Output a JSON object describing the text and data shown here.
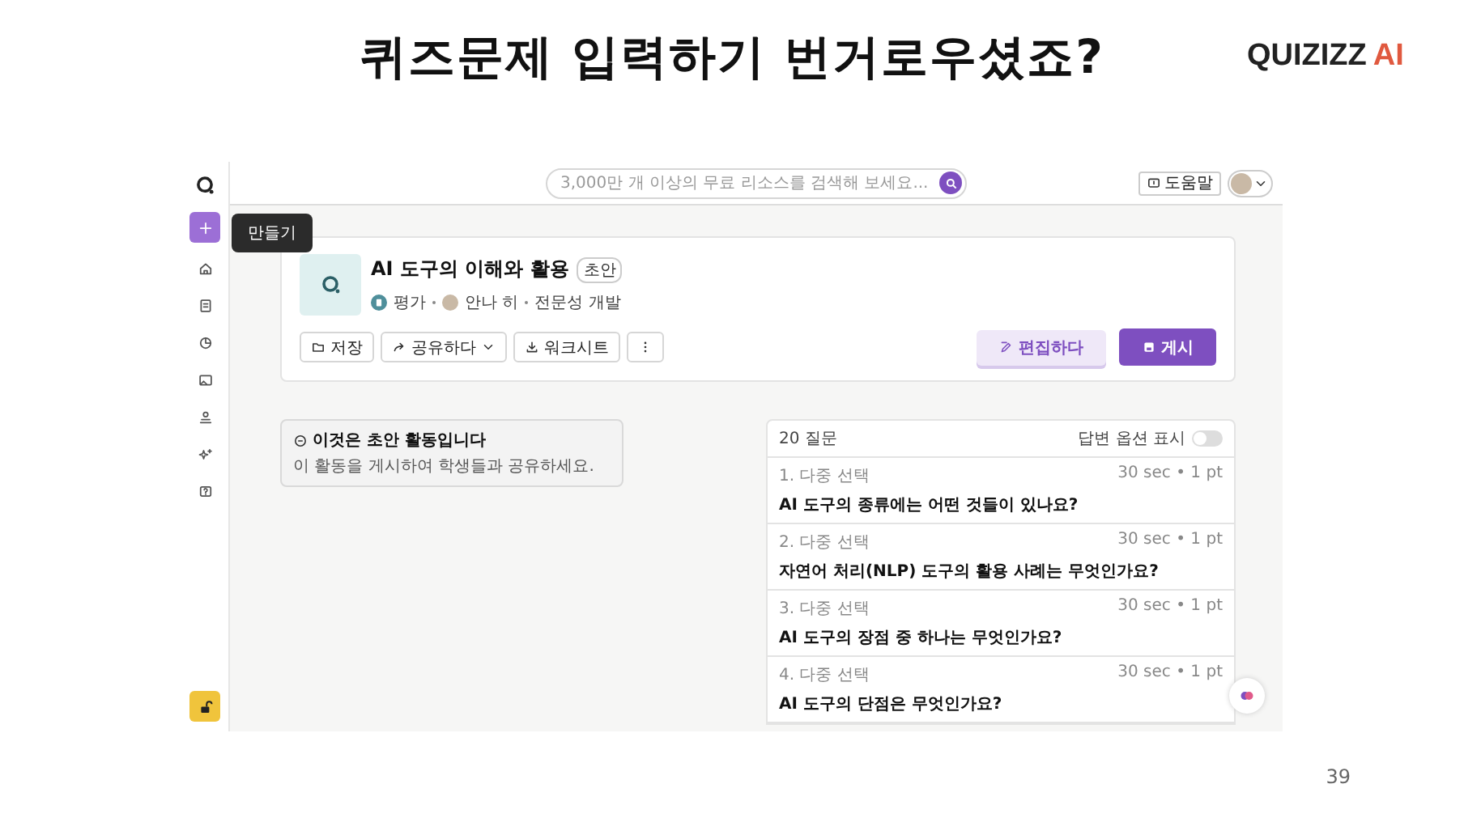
{
  "slide": {
    "title": "퀴즈문제 입력하기 번거로우셨죠?",
    "logo": {
      "word": "QUIZIZZ",
      "ai": "AI"
    },
    "page_number": "39"
  },
  "app": {
    "search": {
      "placeholder": "3,000만 개 이상의 무료 리소스를 검색해 보세요..."
    },
    "help_button": "도움말",
    "tooltip": "만들기",
    "activity": {
      "title": "AI 도구의 이해와 활용",
      "badge": "초안",
      "type": "평가",
      "author": "안나 히",
      "category": "전문성 개발",
      "actions": [
        {
          "kind": "folder",
          "label": "저장"
        },
        {
          "kind": "share",
          "label": "공유하다"
        },
        {
          "kind": "download",
          "label": "워크시트"
        },
        {
          "kind": "more"
        }
      ],
      "edit_button": "편집하다",
      "publish_button": "게시"
    },
    "draft_notice": {
      "title": "이것은 초안 활동입니다",
      "text": "이 활동을 게시하여 학생들과 공유하세요."
    },
    "questions": {
      "count": "20 질문",
      "toggle_label": "답변 옵션 표시",
      "toggle_on": false,
      "items": [
        {
          "type": "1. 다중 선택",
          "meta": "30 sec • 1 pt",
          "text": "AI 도구의 종류에는 어떤 것들이 있나요?"
        },
        {
          "type": "2. 다중 선택",
          "meta": "30 sec • 1 pt",
          "text": "자연어 처리(NLP) 도구의 활용 사례는 무엇인가요?"
        },
        {
          "type": "3. 다중 선택",
          "meta": "30 sec • 1 pt",
          "text": "AI 도구의 장점 중 하나는 무엇인가요?"
        },
        {
          "type": "4. 다중 선택",
          "meta": "30 sec • 1 pt",
          "text": "AI 도구의 단점은 무엇인가요?"
        }
      ]
    }
  }
}
